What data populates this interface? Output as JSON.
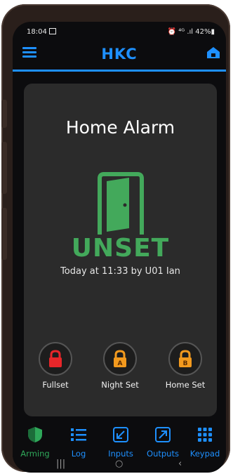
{
  "status_bar": {
    "time": "18:04",
    "icons": "⏰ ⁴ᴳ .ıl 42%▮"
  },
  "app_bar": {
    "brand": "HKC",
    "menu_icon": "menu-icon",
    "home_icon": "home-icon"
  },
  "panel": {
    "title": "Home Alarm",
    "state": "UNSET",
    "last_event": "Today at 11:33 by U01 Ian",
    "state_color": "#43a95b"
  },
  "arming_buttons": [
    {
      "label": "Fullset",
      "icon": "lock-icon",
      "color": "#e8262a"
    },
    {
      "label": "Night Set",
      "icon": "lock-a-icon",
      "color": "#f39a1e"
    },
    {
      "label": "Home Set",
      "icon": "lock-b-icon",
      "color": "#f39a1e"
    }
  ],
  "tabs": [
    {
      "label": "Arming",
      "active": true,
      "color": "#2fa85a"
    },
    {
      "label": "Log",
      "color": "#1e90ff"
    },
    {
      "label": "Inputs",
      "color": "#1e90ff"
    },
    {
      "label": "Outputs",
      "color": "#1e90ff"
    },
    {
      "label": "Keypad",
      "color": "#1e90ff"
    }
  ],
  "nav": {
    "recents": "|||",
    "home": "○",
    "back": "‹"
  }
}
